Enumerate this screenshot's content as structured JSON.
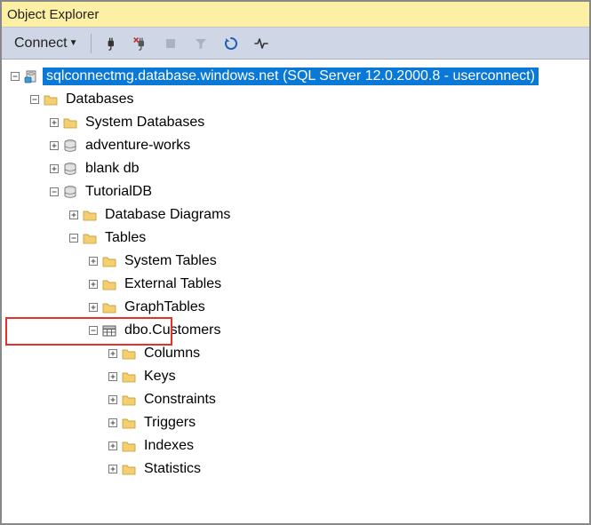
{
  "titlebar": {
    "title": "Object Explorer"
  },
  "toolbar": {
    "connect_label": "Connect"
  },
  "tree": {
    "root_label": "sqlconnectmg.database.windows.net (SQL Server 12.0.2000.8 - userconnect)",
    "databases_label": "Databases",
    "system_databases_label": "System Databases",
    "adventure_works_label": "adventure-works",
    "blank_db_label": "blank db",
    "tutorialdb_label": "TutorialDB",
    "database_diagrams_label": "Database Diagrams",
    "tables_label": "Tables",
    "system_tables_label": "System Tables",
    "external_tables_label": "External Tables",
    "graph_tables_label": "GraphTables",
    "dbo_customers_label": "dbo.Customers",
    "columns_label": "Columns",
    "keys_label": "Keys",
    "constraints_label": "Constraints",
    "triggers_label": "Triggers",
    "indexes_label": "Indexes",
    "statistics_label": "Statistics"
  }
}
